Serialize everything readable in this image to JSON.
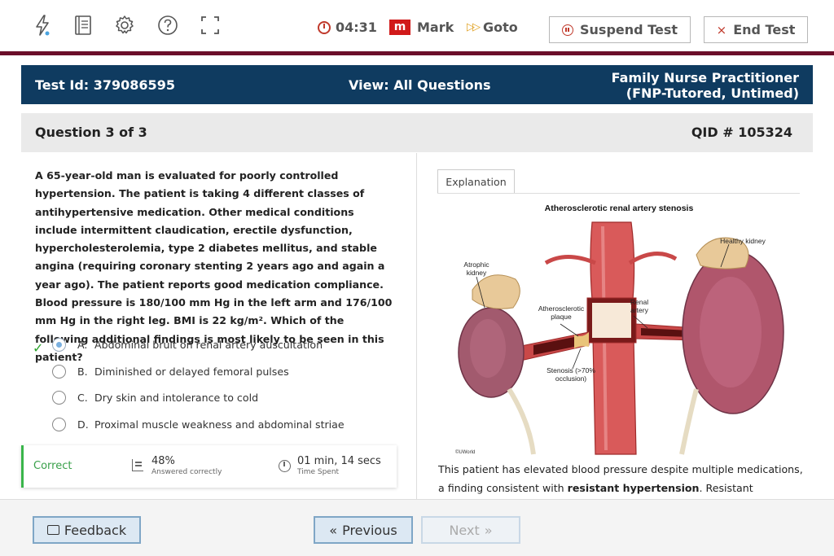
{
  "toolbar": {
    "icons": [
      "lightning-icon",
      "notebook-icon",
      "gear-icon",
      "help-icon",
      "fullscreen-icon"
    ],
    "timer": "04:31",
    "mark_badge": "m",
    "mark_label": "Mark",
    "goto_glyph": "▷▷",
    "goto_label": "Goto",
    "suspend_label": "Suspend Test",
    "end_label": "End Test",
    "end_glyph": "×"
  },
  "header": {
    "test_id": "Test Id: 379086595",
    "view": "View: All Questions",
    "exam_line1": "Family Nurse Practitioner",
    "exam_line2": "(FNP-Tutored, Untimed)"
  },
  "question": {
    "counter": "Question 3 of 3",
    "qid": "QID # 105324",
    "stem": "A 65-year-old man is evaluated for poorly controlled hypertension.  The patient is taking 4 different classes of antihypertensive medication.  Other medical conditions include intermittent claudication, erectile dysfunction, hypercholesterolemia, type 2 diabetes mellitus, and stable angina (requiring coronary stenting 2 years ago and again a year ago).  The patient reports good medication compliance.  Blood pressure is 180/100 mm Hg in the left arm and 176/100 mm Hg in the right leg.  BMI is 22 kg/m².  Which of the following additional findings is most likely to be seen in this patient?",
    "answers": [
      {
        "letter": "A.",
        "text": "Abdominal bruit on renal artery auscultation",
        "selected": true,
        "correct": true
      },
      {
        "letter": "B.",
        "text": "Diminished or delayed femoral pulses",
        "selected": false,
        "correct": false
      },
      {
        "letter": "C.",
        "text": "Dry skin and intolerance to cold",
        "selected": false,
        "correct": false
      },
      {
        "letter": "D.",
        "text": "Proximal muscle weakness and abdominal striae",
        "selected": false,
        "correct": false
      }
    ],
    "check_glyph": "✓"
  },
  "stats": {
    "result": "Correct",
    "percent": "48%",
    "percent_label": "Answered correctly",
    "time": "01 min, 14 secs",
    "time_label": "Time Spent"
  },
  "explanation": {
    "tab_label": "Explanation",
    "figure": {
      "title": "Atherosclerotic renal artery stenosis",
      "label_atrophic": "Atrophic kidney",
      "label_healthy": "Healthy kidney",
      "label_plaque": "Atherosclerotic plaque",
      "label_renal": "Renal artery",
      "label_stenosis": "Stenosis (>70% occlusion)",
      "copyright": "©UWorld"
    },
    "text_start": "This patient has elevated blood pressure despite multiple medications, a finding consistent with ",
    "text_bold": "resistant hypertension",
    "text_end": ".  Resistant hypertension"
  },
  "footer": {
    "feedback_label": "Feedback",
    "previous_label": "Previous",
    "previous_glyph": "«",
    "next_label": "Next",
    "next_glyph": "»"
  },
  "colors": {
    "header_bg": "#0f3b60",
    "maroon_rule": "#6b0f2a",
    "correct_green": "#39b54a",
    "mark_red": "#d11a1a"
  }
}
